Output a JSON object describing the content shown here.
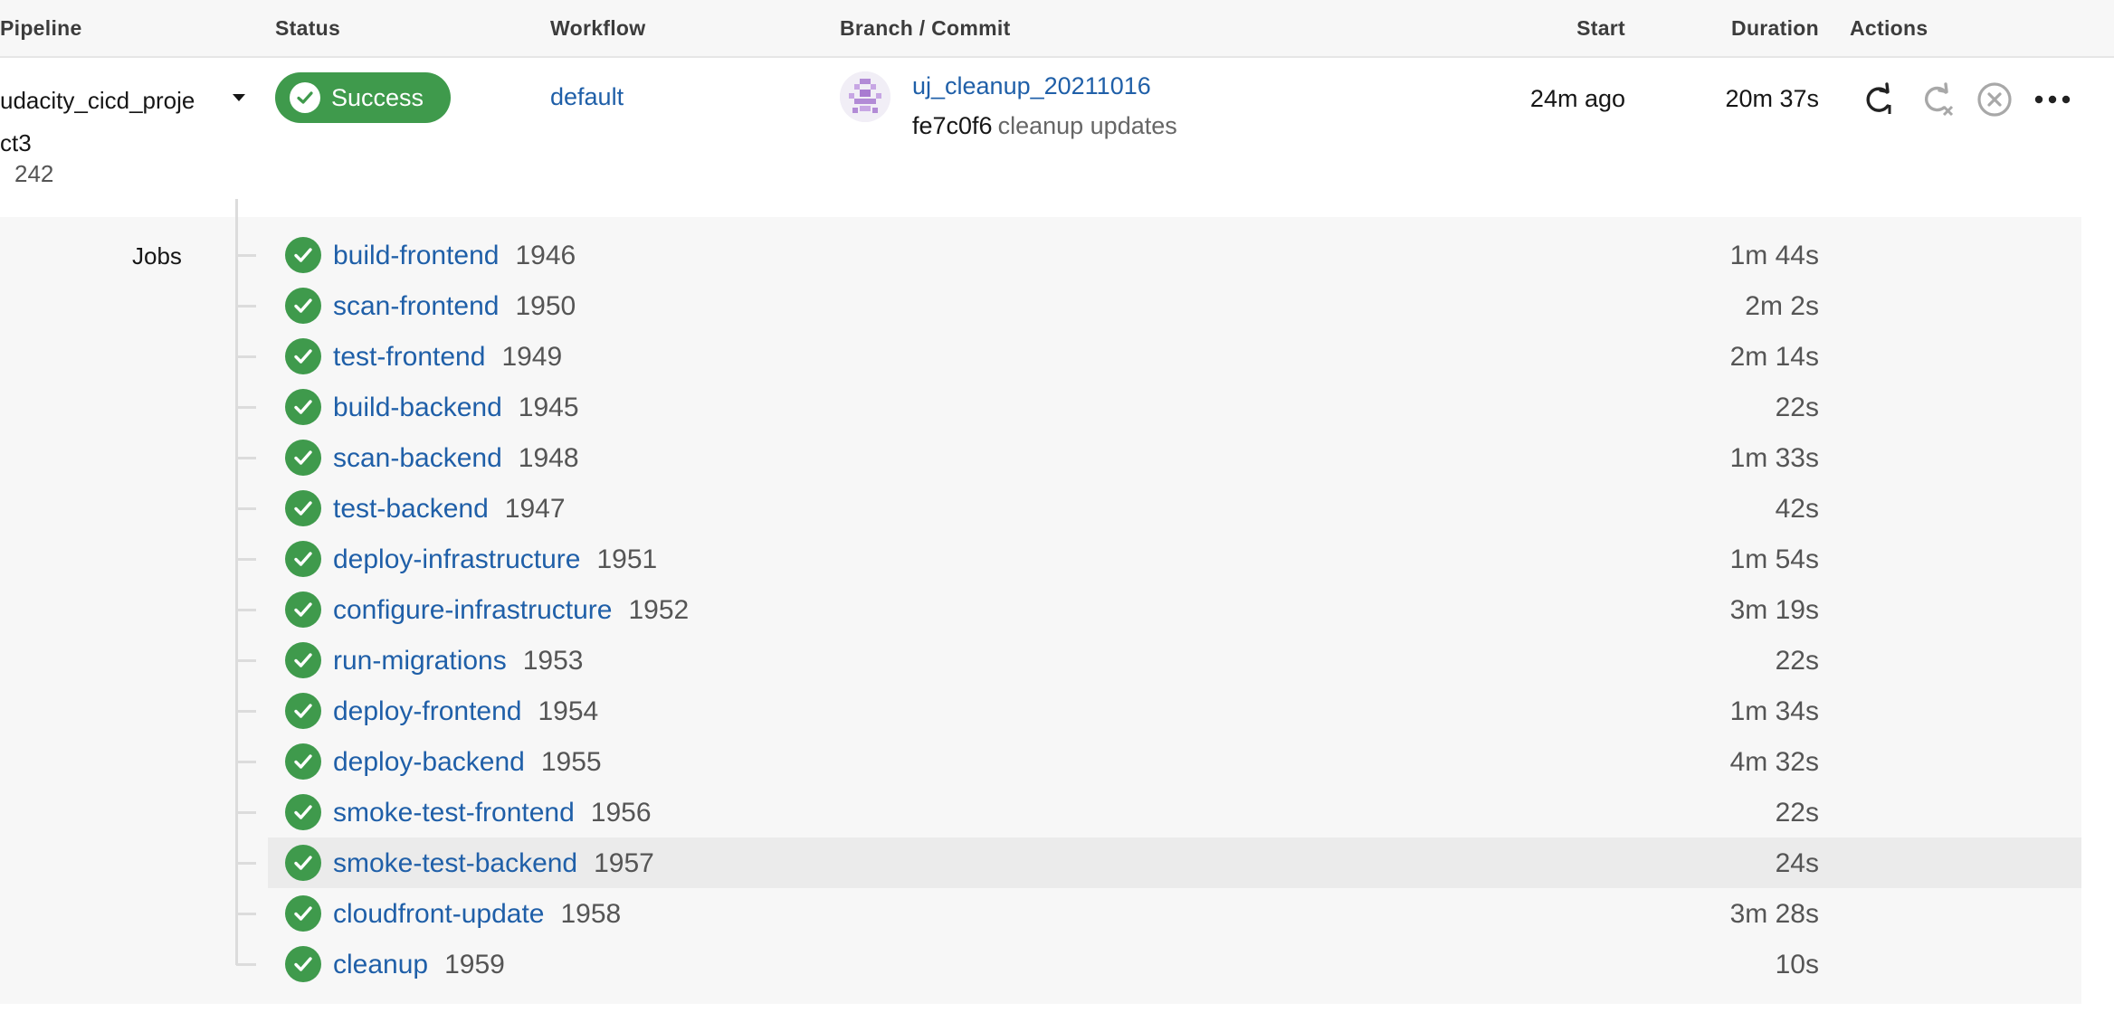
{
  "header": {
    "pipeline": "Pipeline",
    "status": "Status",
    "workflow": "Workflow",
    "branch_commit": "Branch / Commit",
    "start": "Start",
    "duration": "Duration",
    "actions": "Actions"
  },
  "pipeline": {
    "name": "udacity_cicd_project3",
    "number": "242",
    "status": "Success",
    "workflow": "default",
    "branch": "uj_cleanup_20211016",
    "commit_hash": "fe7c0f6",
    "commit_message": "cleanup updates",
    "start": "24m ago",
    "duration": "20m 37s"
  },
  "actions": {
    "icons": [
      "rerun-icon",
      "rerun-failed-icon",
      "cancel-icon",
      "more-icon"
    ]
  },
  "jobs": {
    "label": "Jobs",
    "items": [
      {
        "name": "build-frontend",
        "number": "1946",
        "duration": "1m 44s"
      },
      {
        "name": "scan-frontend",
        "number": "1950",
        "duration": "2m 2s"
      },
      {
        "name": "test-frontend",
        "number": "1949",
        "duration": "2m 14s"
      },
      {
        "name": "build-backend",
        "number": "1945",
        "duration": "22s"
      },
      {
        "name": "scan-backend",
        "number": "1948",
        "duration": "1m 33s"
      },
      {
        "name": "test-backend",
        "number": "1947",
        "duration": "42s"
      },
      {
        "name": "deploy-infrastructure",
        "number": "1951",
        "duration": "1m 54s"
      },
      {
        "name": "configure-infrastructure",
        "number": "1952",
        "duration": "3m 19s"
      },
      {
        "name": "run-migrations",
        "number": "1953",
        "duration": "22s"
      },
      {
        "name": "deploy-frontend",
        "number": "1954",
        "duration": "1m 34s"
      },
      {
        "name": "deploy-backend",
        "number": "1955",
        "duration": "4m 32s"
      },
      {
        "name": "smoke-test-frontend",
        "number": "1956",
        "duration": "22s"
      },
      {
        "name": "smoke-test-backend",
        "number": "1957",
        "duration": "24s"
      },
      {
        "name": "cloudfront-update",
        "number": "1958",
        "duration": "3m 28s"
      },
      {
        "name": "cleanup",
        "number": "1959",
        "duration": "10s"
      }
    ]
  },
  "colors": {
    "success": "#3f9a4c",
    "link": "#1f5fa8",
    "header_bg": "#f7f7f7",
    "highlight_row": "#ebebeb"
  }
}
